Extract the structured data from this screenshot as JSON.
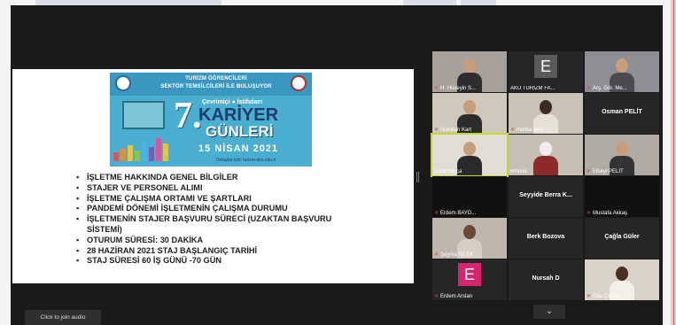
{
  "banner": {
    "line1": "TURİZM ÖĞRENCİLERİ",
    "line2": "SEKTÖR TEMSİLCİLERİ İLE BULUŞUYOR",
    "number": "7.",
    "online": "Çevrimiçi",
    "employment": "İstihdam",
    "title1": "KARİYER",
    "title2": "GÜNLERİ",
    "date": "15 NİSAN 2021",
    "details": "Detaylar için: turizm.aku.edu.tr"
  },
  "bullets": [
    "İŞLETME HAKKINDA GENEL BİLGİLER",
    "STAJER VE PERSONEL ALIMI",
    "İŞLETME ÇALIŞMA ORTAMI VE ŞARTLARI",
    "PANDEMİ DÖNEMİ İŞLETMENİN ÇALIŞMA DURUMU",
    "İŞLETMENİN STAJER BAŞVURU SÜRECİ (UZAKTAN BAŞVURU SİSTEMİ)",
    "OTURUM SÜRESİ: 30 DAKİKA",
    "28 HAZİRAN 2021 STAJ BAŞLANGIÇ TARİHİ",
    "STAJ SÜRESİ 60 İŞ GÜNÜ -70 GÜN"
  ],
  "participants": {
    "p1": "H. Hüseyin S...",
    "p2_letter": "E",
    "p2": "AKÜ TURİZM FA...",
    "p3": "Arş. Gör. Me...",
    "p4": "Nurullah Kart",
    "p5": "melisa ateş",
    "p6": "Osman PELİT",
    "p7": "Ercan Hoca",
    "p8": "iPhone",
    "p9": "Elbeyi PELİT",
    "p10": "Erdem BAYD...",
    "p11": "Seyyide Berra K...",
    "p12": "Mustafa Akkaş",
    "p13": "Şeyma İŞLEK",
    "p14": "Berk Bozova",
    "p15": "Çağla Güler",
    "p16_letter": "E",
    "p16": "Erdem Arslan",
    "p17": "Nursah D",
    "p18": "Eda Çoban"
  },
  "controls": {
    "audio": "Click to join audio",
    "chevron": "⌄"
  },
  "colors": {
    "active_speaker": "#c3d82e",
    "muted_mic": "#e04040",
    "avatar_grey": "#5a5a5a",
    "avatar_pink": "#d6246e"
  }
}
